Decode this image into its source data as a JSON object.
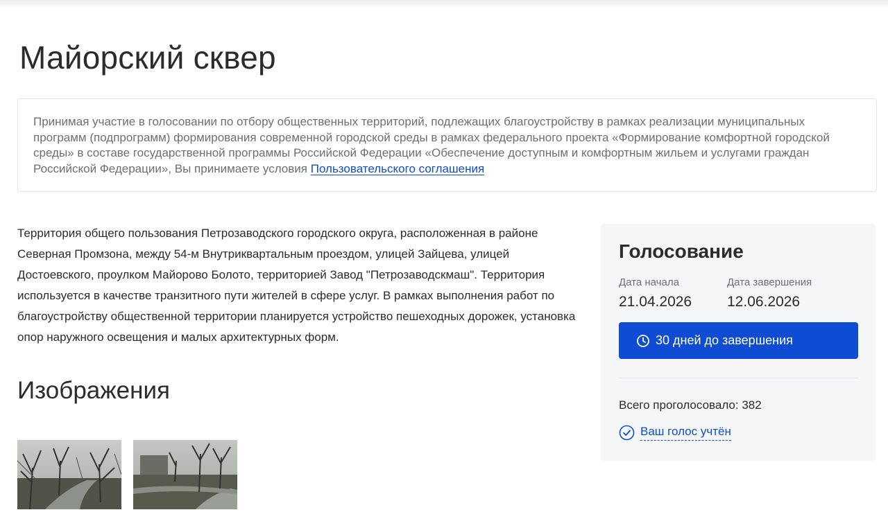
{
  "page": {
    "title": "Майорский сквер"
  },
  "notice": {
    "text": "Принимая участие в голосовании по отбору общественных территорий, подлежащих благоустройству в рамках реализации муниципальных программ (подпрограмм) формирования современной городской среды в рамках федерального проекта «Формирование комфортной городской среды» в составе государственной программы Российской Федерации «Обеспечение доступным и комфортным жильем и услугами граждан Российской Федерации», Вы принимаете условия ",
    "link_label": "Пользовательского соглашения"
  },
  "description": {
    "text": "Территория общего пользования Петрозаводского городского округа, расположенная в районе Северная Промзона, между 54-м Внутриквартальным проездом, улицей Зайцева, улицей Достоевского, проулком Майорово Болото, территорией Завод \"Петрозаводскмаш\". Территория используется в качестве транзитного пути жителей в сфере услуг. В рамках выполнения работ по благоустройству общественной территории планируется устройство пешеходных дорожек, установка опор наружного освещения и малых архитектурных форм."
  },
  "images": {
    "title": "Изображения"
  },
  "voting": {
    "title": "Голосование",
    "start_label": "Дата начала",
    "start_value": "21.04.2026",
    "end_label": "Дата завершения",
    "end_value": "12.06.2026",
    "deadline_label": "30 дней до завершения",
    "total_label": "Всего проголосовало: 382",
    "voted_label": "Ваш голос учтён",
    "colors": {
      "accent": "#0d4cd3",
      "card_bg": "#f5f6f8"
    },
    "icons": {
      "deadline": "clock-icon",
      "voted": "check-circle-icon"
    }
  }
}
